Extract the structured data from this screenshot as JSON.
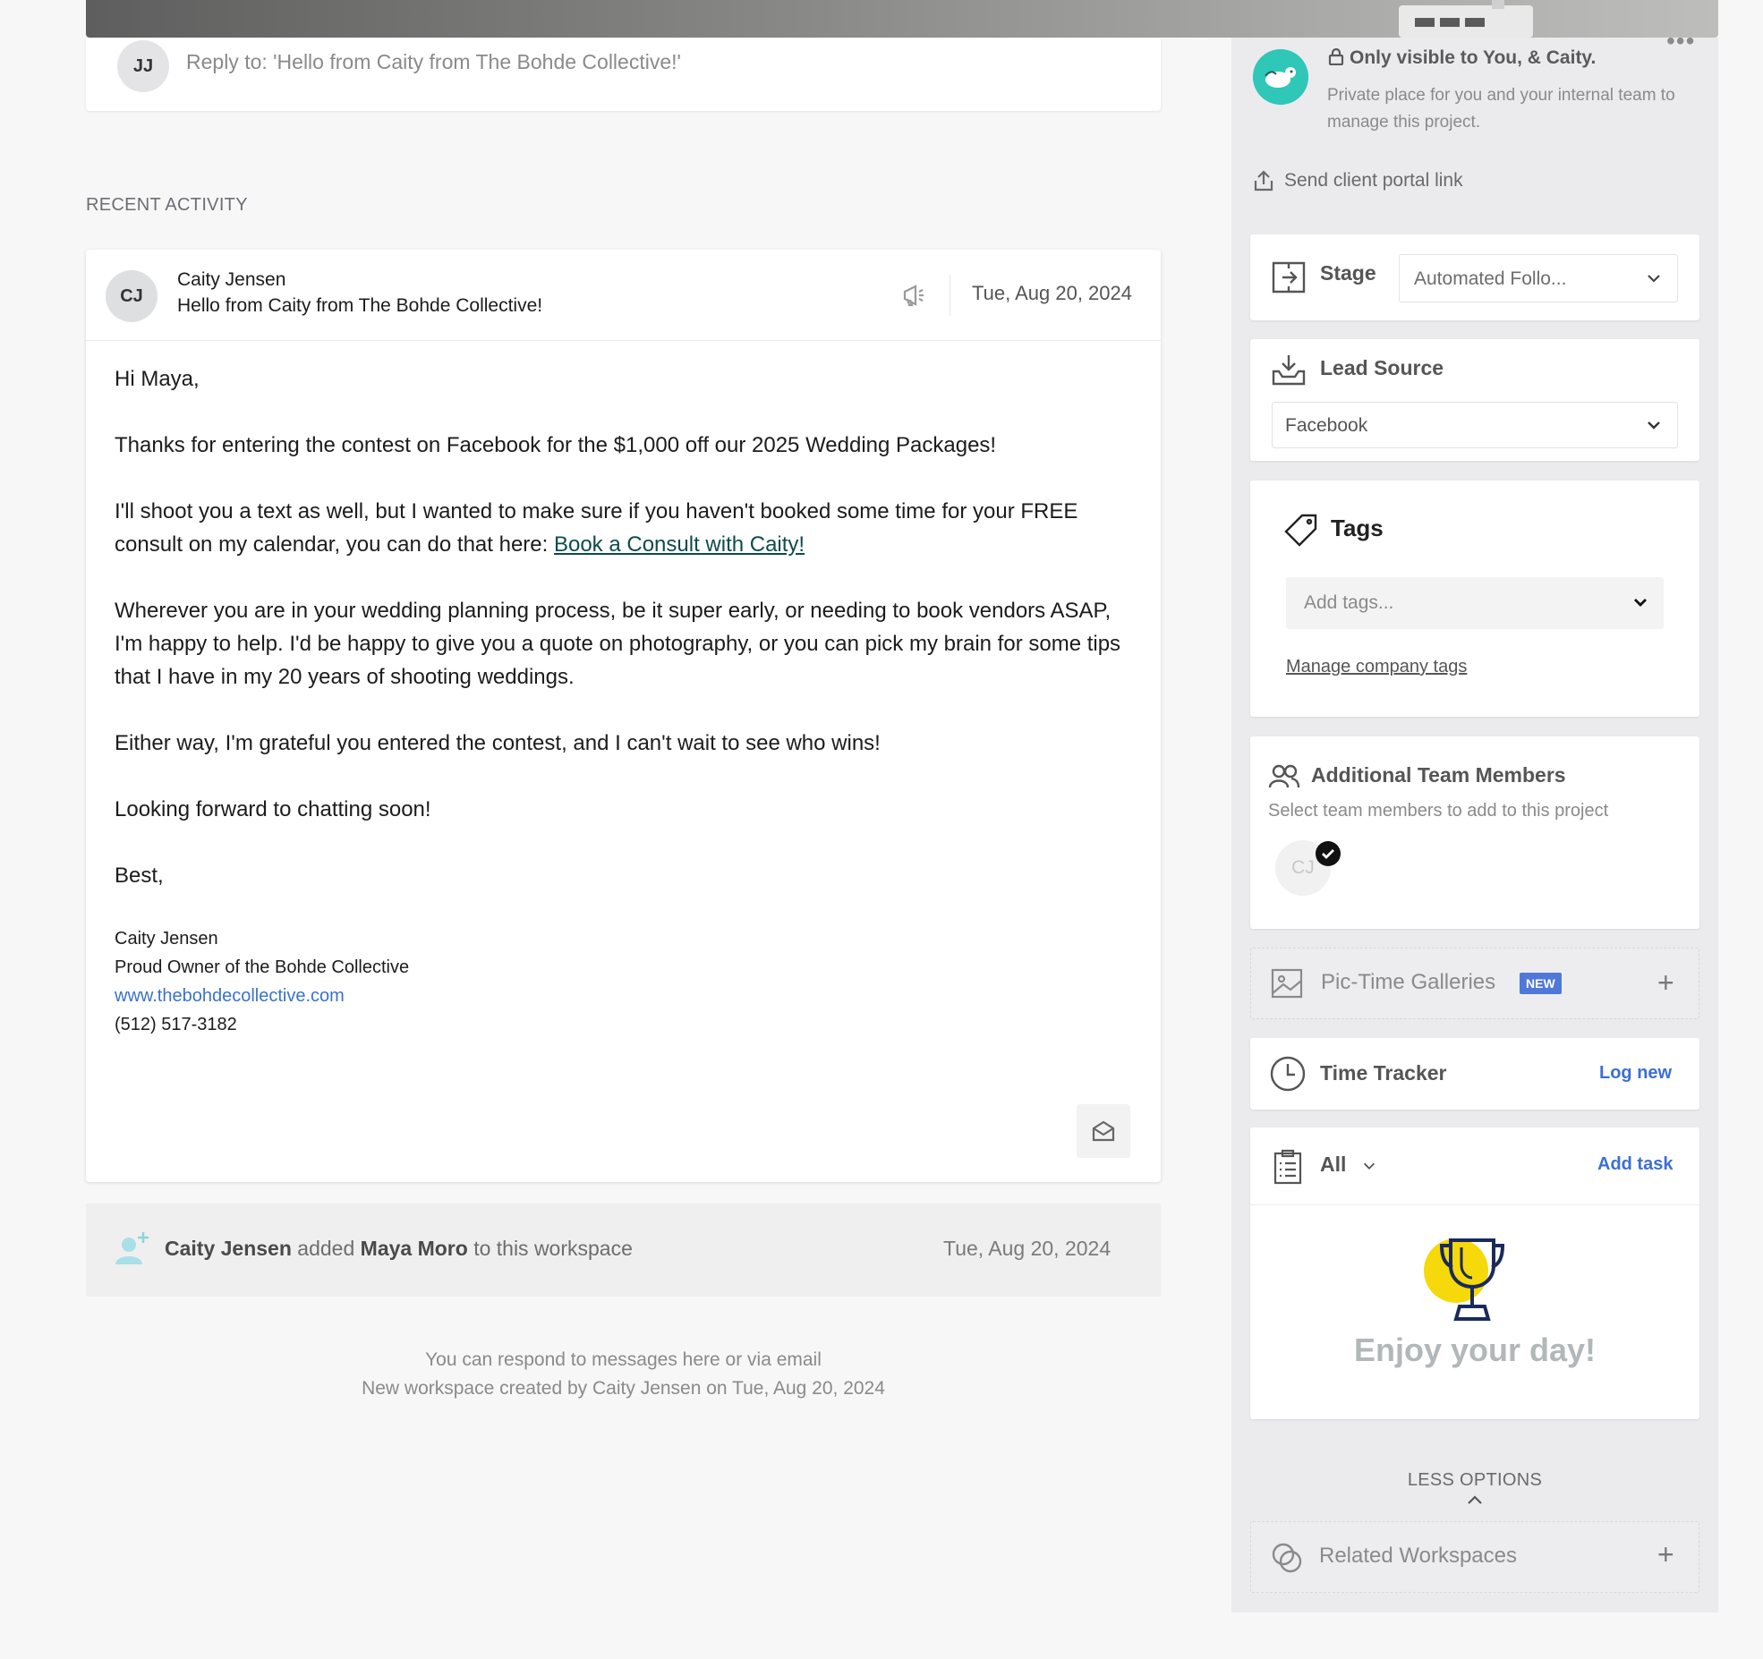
{
  "reply": {
    "avatar_initials": "JJ",
    "placeholder": "Reply to: 'Hello from Caity from The Bohde Collective!'"
  },
  "recent_activity_label": "RECENT ACTIVITY",
  "email": {
    "avatar_initials": "CJ",
    "sender": "Caity Jensen",
    "subject": "Hello from Caity from The Bohde Collective!",
    "date": "Tue, Aug 20, 2024",
    "greeting": "Hi Maya,",
    "p1": "Thanks for entering the contest on Facebook for the $1,000 off our 2025 Wedding Packages!",
    "p2_before_link": "I'll shoot you a text as well, but I wanted to make sure if you haven't booked some time for your FREE consult on my calendar, you can do that here: ",
    "p2_link": "Book a Consult with Caity!",
    "p3": "Wherever you are in your wedding planning process, be it super early, or needing to book vendors ASAP, I'm happy to help. I'd be happy to give you a quote on photography, or you can pick my brain for some tips that I have in my 20 years of shooting weddings.",
    "p4": "Either way, I'm grateful you entered the contest, and I can't wait to see who wins!",
    "p5": "Looking forward to chatting soon!",
    "signoff": "Best,",
    "sig_name": "Caity Jensen",
    "sig_title": "Proud Owner of the Bohde Collective",
    "sig_website": "www.thebohdecollective.com",
    "sig_phone": "(512) 517-3182"
  },
  "activity": {
    "actor": "Caity Jensen",
    "verb": "added",
    "target": "Maya Moro",
    "rest": "to this workspace",
    "date": "Tue, Aug 20, 2024"
  },
  "footer": {
    "line1": "You can respond to messages here or via email",
    "line2": "New workspace created by Caity Jensen on Tue, Aug 20, 2024"
  },
  "sidebar": {
    "visibility_title": "Only visible to You, & Caity.",
    "visibility_sub": "Private place for you and your internal team to manage this project.",
    "portal_link": "Send client portal link",
    "stage_label": "Stage",
    "stage_value": "Automated Follo...",
    "lead_source_label": "Lead Source",
    "lead_source_value": "Facebook",
    "tags_label": "Tags",
    "tags_placeholder": "Add tags...",
    "manage_tags": "Manage company tags",
    "team_label": "Additional Team Members",
    "team_sub": "Select team members to add to this project",
    "team_member_initials": "CJ",
    "pictime_label": "Pic-Time Galleries",
    "pictime_badge": "NEW",
    "time_tracker_label": "Time Tracker",
    "time_tracker_action": "Log new",
    "tasks_filter": "All",
    "tasks_action": "Add task",
    "tasks_empty": "Enjoy your day!",
    "less_options": "LESS OPTIONS",
    "related_label": "Related Workspaces"
  },
  "colors": {
    "accent_blue": "#3b6fd6",
    "link_teal": "#0d4b4b",
    "badge_blue": "#4f78d9",
    "trophy_yellow": "#f5d90a"
  },
  "icons": [
    "lock-icon",
    "upload-icon",
    "stage-icon",
    "inbox-icon",
    "tag-icon",
    "users-icon",
    "image-icon",
    "clock-icon",
    "clipboard-icon",
    "trophy-icon",
    "megaphone-icon",
    "mail-open-icon",
    "add-user-icon",
    "link-circles-icon",
    "chevron-down-icon",
    "chevron-up-icon",
    "plus-icon",
    "more-icon",
    "check-icon"
  ]
}
